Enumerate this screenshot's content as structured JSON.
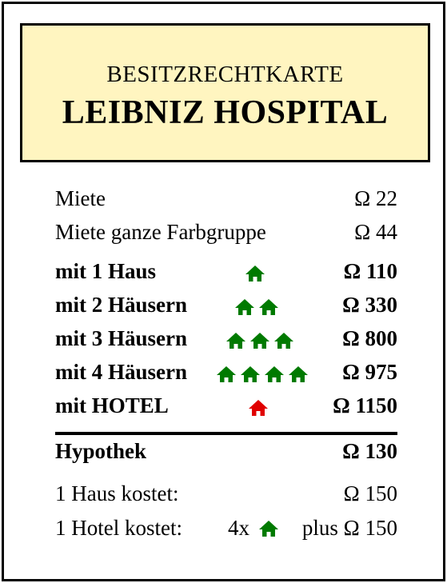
{
  "card": {
    "subtitle": "BESITZRECHTKARTE",
    "title": "LEIBNIZ HOSPITAL",
    "colors": {
      "title_bg": "#fff5c0",
      "house": "#007a00",
      "hotel": "#e00000"
    }
  },
  "rent": {
    "base": {
      "label": "Miete",
      "value": "Ω 22"
    },
    "group": {
      "label": "Miete ganze Farbgruppe",
      "value": "Ω 44"
    },
    "h1": {
      "label": "mit 1 Haus",
      "value": "Ω 110",
      "houses": 1
    },
    "h2": {
      "label": "mit 2 Häusern",
      "value": "Ω 330",
      "houses": 2
    },
    "h3": {
      "label": "mit 3 Häusern",
      "value": "Ω 800",
      "houses": 3
    },
    "h4": {
      "label": "mit 4 Häusern",
      "value": "Ω 975",
      "houses": 4
    },
    "hotel": {
      "label": "mit HOTEL",
      "value": "Ω 1150",
      "hotels": 1
    }
  },
  "mortgage": {
    "label": "Hypothek",
    "value": "Ω 130"
  },
  "costs": {
    "house": {
      "label": "1 Haus kostet:",
      "value": "Ω 150"
    },
    "hotel": {
      "label": "1 Hotel kostet:",
      "prefix": "4x",
      "suffix": "plus Ω 150"
    }
  },
  "icons": {
    "house": "house-icon",
    "hotel": "hotel-icon"
  }
}
